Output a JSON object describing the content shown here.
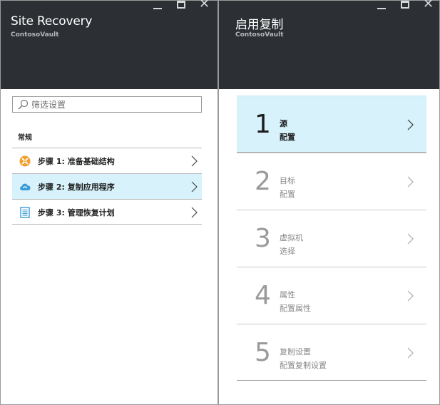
{
  "left_blade": {
    "title": "Site Recovery",
    "subtitle": "ContosoVault",
    "search": {
      "placeholder": "筛选设置"
    },
    "section_label": "常规",
    "steps": [
      {
        "label": "步骤 1: 准备基础结构",
        "icon": "tools-icon",
        "selected": false
      },
      {
        "label": "步骤 2: 复制应用程序",
        "icon": "cloud-replicate-icon",
        "selected": true
      },
      {
        "label": "步骤 3: 管理恢复计划",
        "icon": "recovery-plan-icon",
        "selected": false
      }
    ]
  },
  "right_blade": {
    "title": "启用复制",
    "subtitle": "ContosoVault",
    "wizard_steps": [
      {
        "number": "1",
        "title": "源",
        "subtitle": "配置",
        "active": true
      },
      {
        "number": "2",
        "title": "目标",
        "subtitle": "配置",
        "active": false
      },
      {
        "number": "3",
        "title": "虚拟机",
        "subtitle": "选择",
        "active": false
      },
      {
        "number": "4",
        "title": "属性",
        "subtitle": "配置属性",
        "active": false
      },
      {
        "number": "5",
        "title": "复制设置",
        "subtitle": "配置复制设置",
        "active": false
      }
    ]
  },
  "colors": {
    "header_bg": "#2c2f33",
    "selected_bg": "#d7f2fb",
    "tools_icon": "#f0a030",
    "cloud_icon": "#3a9bd8"
  }
}
